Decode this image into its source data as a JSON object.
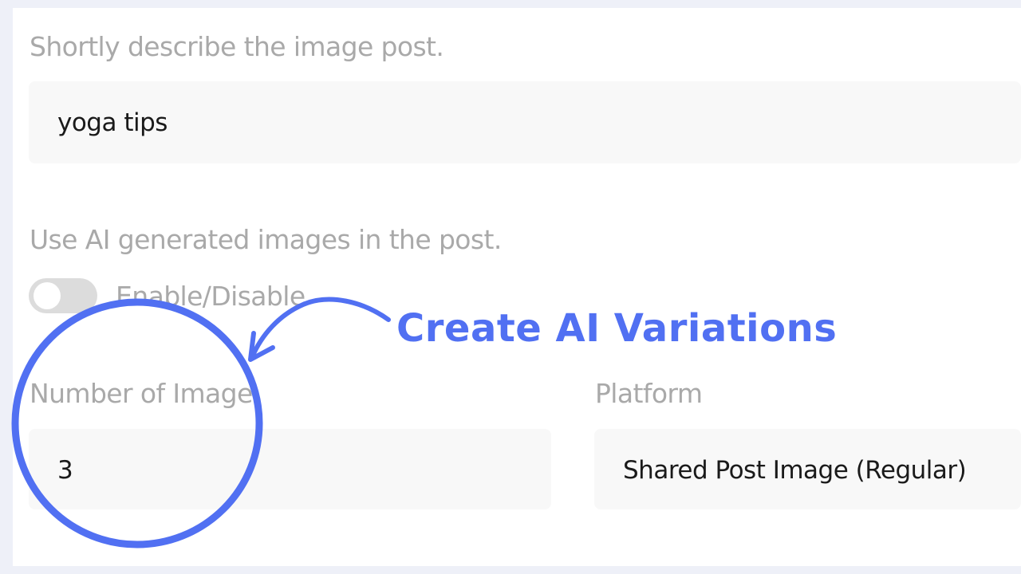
{
  "form": {
    "description": {
      "label": "Shortly describe the image post.",
      "value": "yoga tips"
    },
    "ai_images": {
      "label": "Use AI generated images in the post.",
      "toggle_label": "Enable/Disable",
      "enabled": false
    },
    "number_of_images": {
      "label": "Number of Image",
      "value": "3"
    },
    "platform": {
      "label": "Platform",
      "value": "Shared Post Image (Regular)"
    }
  },
  "annotation": {
    "text": "Create AI Variations",
    "color": "#5170f2"
  },
  "colors": {
    "background": "#eef0f8",
    "panel": "#ffffff",
    "label_text": "#a9a9a9",
    "field_bg": "#f8f8f8",
    "value_text": "#1a1a1a",
    "toggle_off": "#dcdcdc"
  }
}
